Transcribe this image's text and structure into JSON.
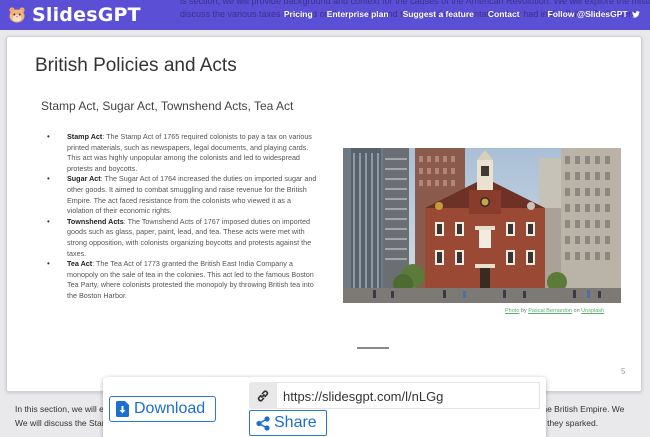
{
  "header": {
    "bg_text_line1": "is section, we will provide background and context for the causes of the American Revolution. We will explore the mistreatment of colonial Americans and",
    "bg_text_line2": "discuss the various taxes imposed on the colonies and the lack of representation they had in the British Parliament.",
    "logo_text": "SlidesGPT",
    "nav": {
      "pricing": "Pricing",
      "enterprise": "Enterprise plan",
      "suggest": "Suggest a feature",
      "contact": "Contact",
      "follow": "Follow @SlidesGPT"
    },
    "accent_color": "#5b4fd6"
  },
  "slide": {
    "title": "British Policies and Acts",
    "subtitle": "Stamp Act, Sugar Act, Townshend Acts, Tea Act",
    "bullets": [
      {
        "term": "Stamp Act",
        "text": ": The Stamp Act of 1765 required colonists to pay a tax on various printed materials, such as newspapers, legal documents, and playing cards. This act was highly unpopular among the colonists and led to widespread protests and boycotts."
      },
      {
        "term": "Sugar Act",
        "text": ": The Sugar Act of 1764 increased the duties on imported sugar and other goods. It aimed to combat smuggling and raise revenue for the British Empire. The act faced resistance from the colonists who viewed it as a violation of their economic rights."
      },
      {
        "term": "Townshend Acts",
        "text": ": The Townshend Acts of 1767 imposed duties on imported goods such as glass, paper, paint, lead, and tea. These acts were met with strong opposition, with colonists organizing boycotts and protests against the taxes."
      },
      {
        "term": "Tea Act",
        "text": ": The Tea Act of 1773 granted the British East India Company a monopoly on the sale of tea in the colonies. This act led to the famous Boston Tea Party, where colonists protested the monopoly by throwing British tea into the Boston Harbor."
      }
    ],
    "credit": {
      "photo": "Photo",
      "by": "by",
      "author": "Pascal Bernardon",
      "on": "on",
      "source": "Unsplash"
    },
    "page_number": "5"
  },
  "notes": {
    "left_line1": "In this section, we will ex",
    "left_line2": "We will discuss the Stamp Ac",
    "right_line1": "the British Empire. We",
    "right_line2": "e they sparked."
  },
  "share": {
    "download_label": "Download",
    "share_url": "https://slidesgpt.com/l/nLGg",
    "share_label": "Share"
  },
  "icons": [
    "hamster-logo-icon",
    "twitter-icon",
    "download-icon",
    "link-icon",
    "share-icon"
  ]
}
